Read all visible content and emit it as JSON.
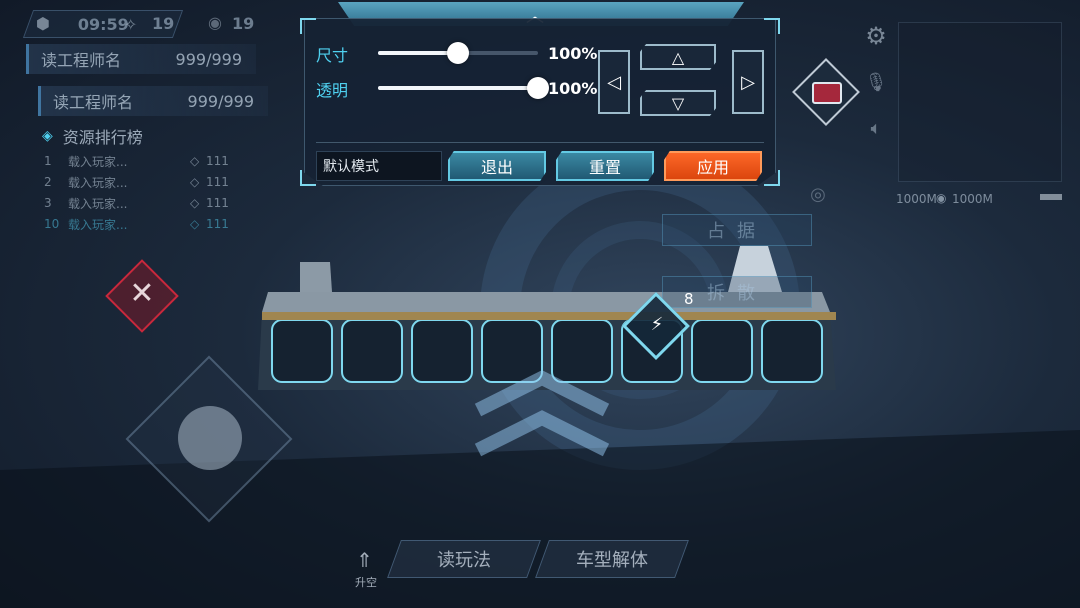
{
  "hud": {
    "timer": "09:59",
    "diamond_count": "19",
    "eye_count": "19"
  },
  "players": [
    {
      "name": "读工程师名",
      "value": "999/999"
    },
    {
      "name": "读工程师名",
      "value": "999/999"
    }
  ],
  "leaderboard": {
    "title": "资源排行榜",
    "rows": [
      {
        "rank": "1",
        "name": "载入玩家...",
        "value": "111"
      },
      {
        "rank": "2",
        "name": "载入玩家...",
        "value": "111"
      },
      {
        "rank": "3",
        "name": "载入玩家...",
        "value": "111"
      },
      {
        "rank": "10",
        "name": "载入玩家...",
        "value": "111"
      }
    ]
  },
  "edit_panel": {
    "size_label": "尺寸",
    "size_value": "100%",
    "size_level": 0.5,
    "opacity_label": "透明",
    "opacity_value": "100%",
    "opacity_level": 1.0,
    "mode_field": "默认模式",
    "exit_label": "退出",
    "reset_label": "重置",
    "apply_label": "应用"
  },
  "side_actions": {
    "occupy_label": "占据",
    "disband_label": "拆散"
  },
  "minimap": {
    "distance_left": "1000M",
    "distance_right": "1000M"
  },
  "block_count": "8",
  "bottom": {
    "lift_label": "升空",
    "rules_label": "读玩法",
    "disassemble_label": "车型解体"
  },
  "colors": {
    "accent_cyan": "#4fd1f0",
    "apply_orange": "#ff6a2a",
    "close_red": "#c8283c",
    "panel_bg": "#16223a"
  }
}
